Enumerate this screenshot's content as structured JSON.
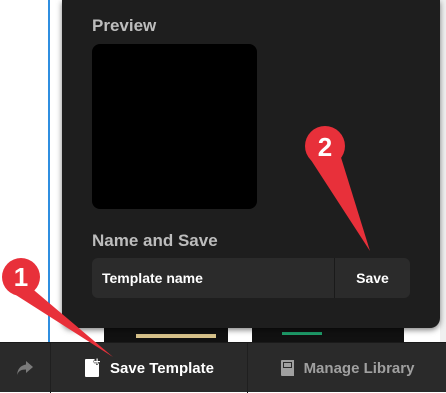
{
  "panel": {
    "preview_label": "Preview",
    "name_label": "Name and Save",
    "template_name_placeholder": "Template name",
    "save_label": "Save"
  },
  "bottom_bar": {
    "share_icon": "share-arrow-icon",
    "save_template_label": "Save Template",
    "save_template_icon": "file-add-icon",
    "manage_library_label": "Manage Library",
    "manage_library_icon": "library-book-icon"
  },
  "annotations": {
    "marker_1": "1",
    "marker_2": "2",
    "color": "#e8303a"
  }
}
